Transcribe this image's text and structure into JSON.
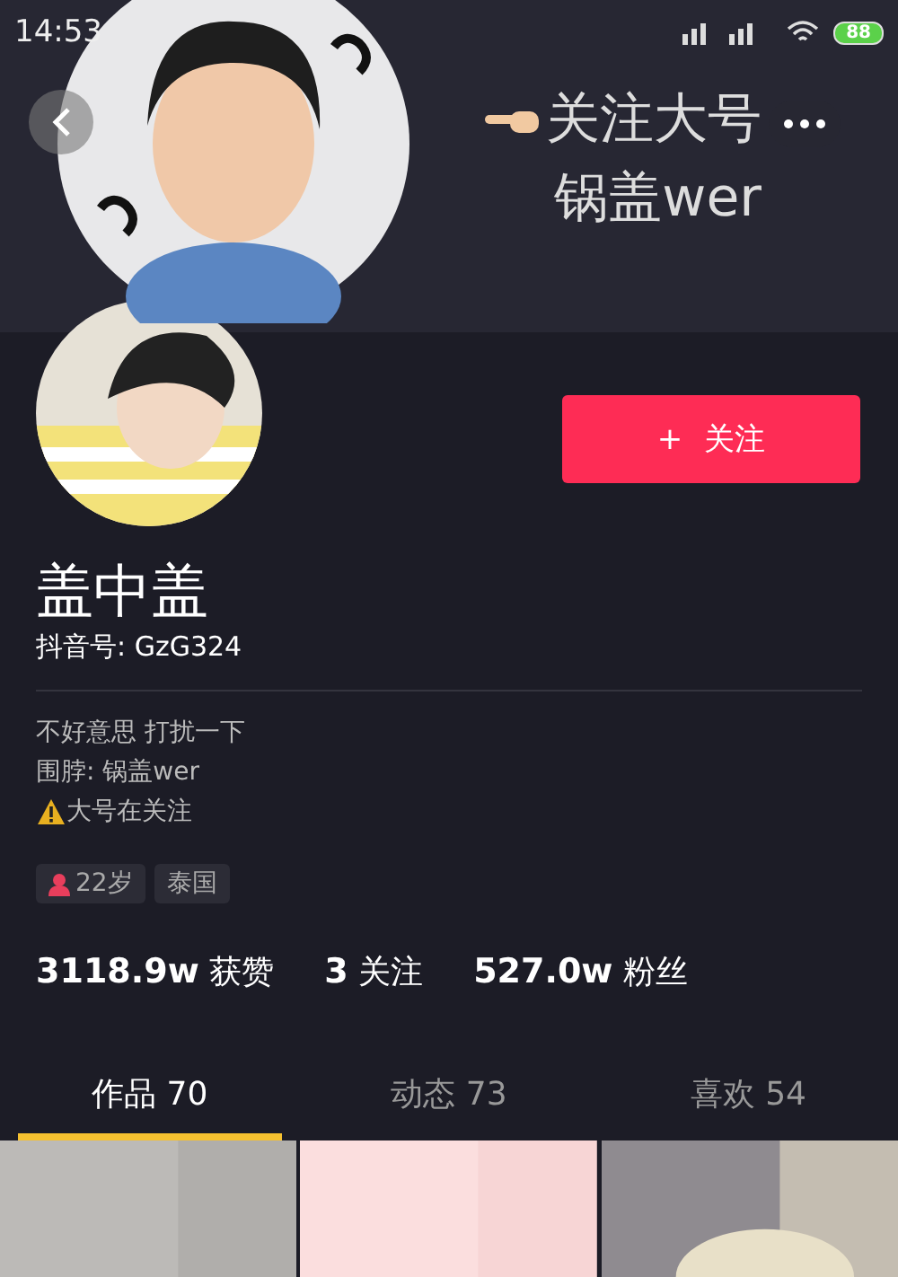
{
  "status_bar": {
    "time": "14:53",
    "battery": "88"
  },
  "cover": {
    "kind": "picture",
    "caption_lines": [
      "关注大号",
      "锅盖wer"
    ]
  },
  "follow_button": {
    "icon": "+",
    "label": "关注"
  },
  "profile": {
    "name": "盖中盖",
    "id_line": "抖音号: GzG324",
    "bio": [
      {
        "kind": "text",
        "text": "不好意思 打扰一下"
      },
      {
        "kind": "text",
        "text": "围脖: 锅盖wer"
      },
      {
        "kind": "warning",
        "text": "大号在关注"
      }
    ],
    "tags": [
      {
        "kind": "gender",
        "label": "22岁"
      },
      {
        "kind": "plain",
        "label": "泰国"
      }
    ]
  },
  "stats": [
    "**3118.9w** 获赞",
    "**3** 关注",
    "**527.0w** 粉丝"
  ],
  "tabs": [
    {
      "label": "作品 70",
      "selected": true
    },
    {
      "label": "动态 73",
      "selected": false
    },
    {
      "label": "喜欢 54",
      "selected": false
    }
  ]
}
